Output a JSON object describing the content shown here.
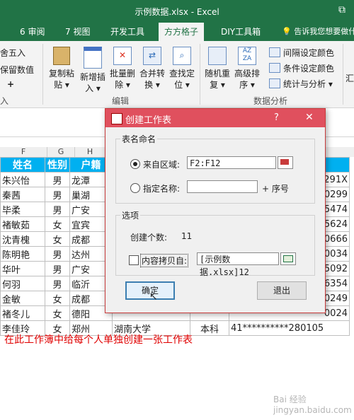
{
  "window": {
    "title": "示例数据.xlsx - Excel"
  },
  "tabs": [
    {
      "label": "6 审阅"
    },
    {
      "label": "7 视图"
    },
    {
      "label": "开发工具"
    },
    {
      "label": "方方格子"
    },
    {
      "label": "DIY工具箱"
    },
    {
      "label": "告诉我您想要做什么"
    }
  ],
  "ribbon": {
    "left_items": [
      "舍五入",
      "保留数值",
      "+"
    ],
    "left_group_label": "入",
    "buttons": [
      {
        "l1": "复制粘",
        "l2": "贴"
      },
      {
        "l1": "新增插",
        "l2": "入"
      },
      {
        "l1": "批量删",
        "l2": "除"
      },
      {
        "l1": "合并转",
        "l2": "换"
      },
      {
        "l1": "查找定",
        "l2": "位"
      },
      {
        "l1": "随机重",
        "l2": "复"
      },
      {
        "l1": "高级排",
        "l2": "序"
      }
    ],
    "edit_group_label": "编辑",
    "right_items": [
      "间隔设定颜色",
      "条件设定颜色",
      "统计与分析"
    ],
    "analysis_group_label": "数据分析",
    "far_right": "汇"
  },
  "sheet": {
    "col_headers": [
      "F",
      "G",
      "H"
    ],
    "header_row": [
      "姓名",
      "性别",
      "户籍"
    ],
    "rows": [
      {
        "name": "朱兴怡",
        "sex": "男",
        "hj": "龙潭",
        "tail": "291X"
      },
      {
        "name": "秦茜",
        "sex": "男",
        "hj": "巢湖",
        "tail": "0299"
      },
      {
        "name": "毕柔",
        "sex": "男",
        "hj": "广安",
        "tail": "5474"
      },
      {
        "name": "褚敏茹",
        "sex": "女",
        "hj": "宜宾",
        "tail": "5624"
      },
      {
        "name": "沈青槐",
        "sex": "女",
        "hj": "成都",
        "tail": "0666"
      },
      {
        "name": "陈明艳",
        "sex": "男",
        "hj": "达州",
        "tail": "0034"
      },
      {
        "name": "华叶",
        "sex": "男",
        "hj": "广安",
        "tail": "5092"
      },
      {
        "name": "何羽",
        "sex": "男",
        "hj": "临沂",
        "tail": "6354"
      },
      {
        "name": "金敏",
        "sex": "女",
        "hj": "成都",
        "tail": "0249"
      },
      {
        "name": "褚冬儿",
        "sex": "女",
        "hj": "德阳",
        "tail": "0024"
      }
    ],
    "last_row": {
      "name": "李佳玲",
      "sex": "女",
      "hj": "郑州",
      "school": "湖南大学",
      "level": "本科",
      "id": "41**********280105"
    },
    "note": "在此工作簿中给每个人单独创建一张工作表"
  },
  "dialog": {
    "title": "创建工作表",
    "help": "?",
    "close": "✕",
    "section_name": "表名命名",
    "from_range_label": "来自区域:",
    "from_range_value": "F2:F12",
    "specify_name_label": "指定名称:",
    "specify_name_value": "",
    "seq_label": "+ 序号",
    "section_options": "选项",
    "create_count_label": "创建个数:",
    "create_count_value": "11",
    "copy_content_label": "内容拷贝自:",
    "copy_content_value": "[示例数据.xlsx]12",
    "ok": "确定",
    "cancel": "退出"
  },
  "watermark": "Bai 经验 jingyan.baidu.com"
}
